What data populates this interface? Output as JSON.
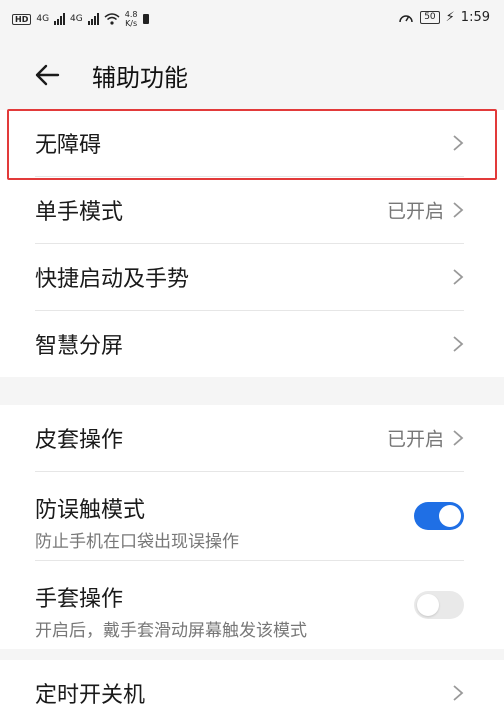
{
  "status_bar": {
    "left_badge": "HD",
    "signal1": "4G",
    "signal2": "4G",
    "net_speed_value": "4.8",
    "net_speed_unit": "K/s",
    "battery": "50",
    "time": "1:59"
  },
  "header": {
    "title": "辅助功能"
  },
  "groups": [
    {
      "rows": [
        {
          "label": "无障碍"
        },
        {
          "label": "单手模式",
          "value": "已开启"
        },
        {
          "label": "快捷启动及手势"
        },
        {
          "label": "智慧分屏"
        }
      ]
    },
    {
      "rows": [
        {
          "label": "皮套操作",
          "value": "已开启"
        },
        {
          "label": "防误触模式",
          "sub": "防止手机在口袋出现误操作",
          "toggle": "on"
        },
        {
          "label": "手套操作",
          "sub": "开启后，戴手套滑动屏幕触发该模式",
          "toggle": "off"
        }
      ]
    },
    {
      "rows": [
        {
          "label": "定时开关机"
        }
      ]
    }
  ],
  "colors": {
    "accent": "#1f6fe5",
    "highlight": "#e23a3a",
    "background": "#f5f5f5"
  }
}
